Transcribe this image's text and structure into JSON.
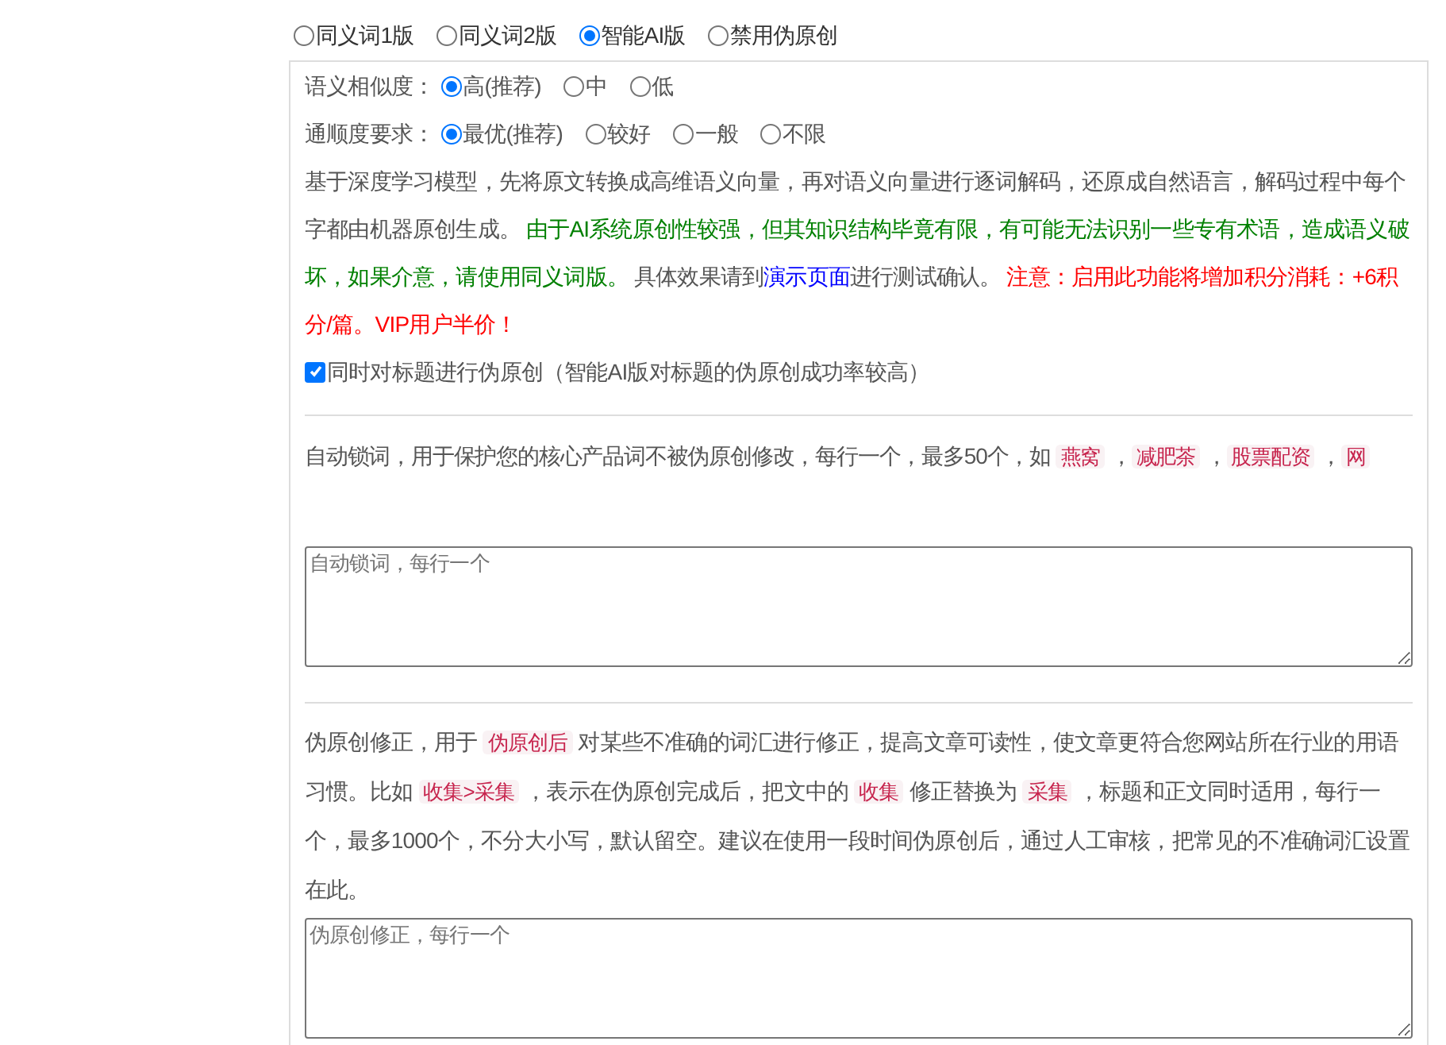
{
  "mode_options": [
    {
      "label": "同义词1版",
      "selected": false
    },
    {
      "label": "同义词2版",
      "selected": false
    },
    {
      "label": "智能AI版",
      "selected": true
    },
    {
      "label": "禁用伪原创",
      "selected": false
    }
  ],
  "ai_settings": {
    "rows": [
      {
        "label": "语义相似度：",
        "options": [
          {
            "label": "高(推荐)",
            "selected": true
          },
          {
            "label": "中",
            "selected": false
          },
          {
            "label": "低",
            "selected": false
          }
        ]
      },
      {
        "label": "通顺度要求：",
        "options": [
          {
            "label": "最优(推荐)",
            "selected": true
          },
          {
            "label": "较好",
            "selected": false
          },
          {
            "label": "一般",
            "selected": false
          },
          {
            "label": "不限",
            "selected": false
          }
        ]
      }
    ],
    "description": [
      {
        "kind": "text",
        "text": "基于深度学习模型，先将原文转换成高维语义向量，再对语义向量进行逐词解码，还原成自然语言，解码过程中每个字都由机器原创生成。 "
      },
      {
        "kind": "green",
        "text": "由于AI系统原创性较强，但其知识结构毕竟有限，有可能无法识别一些专有术语，造成语义破坏，如果介意，请使用同义词版。"
      },
      {
        "kind": "text",
        "text": " 具体效果请到"
      },
      {
        "kind": "link",
        "text": "演示页面"
      },
      {
        "kind": "text",
        "text": "进行测试确认。 "
      },
      {
        "kind": "red",
        "text": "注意：启用此功能将增加积分消耗：+6积分/篇。VIP用户半价！"
      }
    ],
    "title_checkbox": {
      "label": "同时对标题进行伪原创（智能AI版对标题的伪原创成功率较高）",
      "checked": true
    }
  },
  "lock_words": {
    "description": [
      {
        "kind": "text",
        "text": "自动锁词，用于保护您的核心产品词不被伪原创修改，每行一个，最多50个，如 "
      },
      {
        "kind": "tag",
        "text": "燕窝"
      },
      {
        "kind": "text",
        "text": " ，"
      },
      {
        "kind": "tag",
        "text": "减肥茶"
      },
      {
        "kind": "text",
        "text": " ，"
      },
      {
        "kind": "tag",
        "text": "股票配资"
      },
      {
        "kind": "text",
        "text": " ，"
      },
      {
        "kind": "tag",
        "text": "网"
      }
    ],
    "textarea": {
      "placeholder": "自动锁词，每行一个"
    }
  },
  "correction": {
    "description": [
      {
        "kind": "text",
        "text": "伪原创修正，用于 "
      },
      {
        "kind": "tag",
        "text": "伪原创后"
      },
      {
        "kind": "text",
        "text": " 对某些不准确的词汇进行修正，提高文章可读性，使文章更符合您网站所在行业的用语习惯。比如 "
      },
      {
        "kind": "tag",
        "text": "收集>采集"
      },
      {
        "kind": "text",
        "text": " ，表示在伪原创完成后，把文中的 "
      },
      {
        "kind": "tag",
        "text": "收集"
      },
      {
        "kind": "text",
        "text": " 修正替换为 "
      },
      {
        "kind": "tag",
        "text": "采集"
      },
      {
        "kind": "text",
        "text": " ，标题和正文同时适用，每行一个，最多1000个，不分大小写，默认留空。建议在使用一段时间伪原创后，通过人工审核，把常见的不准确词汇设置在此。"
      }
    ],
    "textarea": {
      "placeholder": "伪原创修正，每行一个"
    }
  }
}
